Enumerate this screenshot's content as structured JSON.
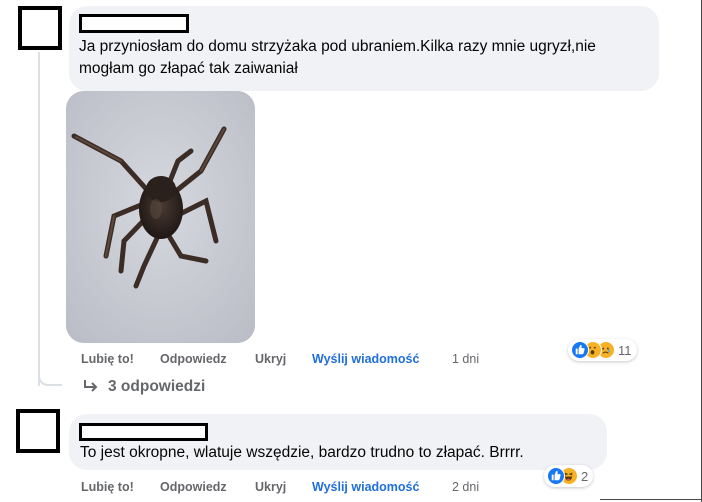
{
  "comments": [
    {
      "text": "Ja przyniosłam do domu strzyżaka pod ubraniem.Kilka razy mnie ugryzł,nie mogłam go złapać tak zaiwaniał",
      "actions": {
        "like": "Lubię to!",
        "reply": "Odpowiedz",
        "hide": "Ukryj",
        "message": "Wyślij wiadomość"
      },
      "time": "1 dni",
      "reactions": {
        "icons": [
          "like-icon",
          "wow-icon",
          "sad-icon"
        ],
        "count": "11"
      },
      "replies_label": "3 odpowiedzi"
    },
    {
      "text": "To jest okropne, wlatuje wszędzie, bardzo trudno to złapać. Brrrr.",
      "actions": {
        "like": "Lubię to!",
        "reply": "Odpowiedz",
        "hide": "Ukryj",
        "message": "Wyślij wiadomość"
      },
      "time": "2 dni",
      "reactions": {
        "icons": [
          "like-icon",
          "haha-icon"
        ],
        "count": "2"
      }
    }
  ],
  "colors": {
    "bubble": "#f0f2f5",
    "action_gray": "#65676b",
    "action_blue": "#216fdb",
    "like_blue": "#1877f2",
    "emoji_yellow": "#f7b125"
  }
}
